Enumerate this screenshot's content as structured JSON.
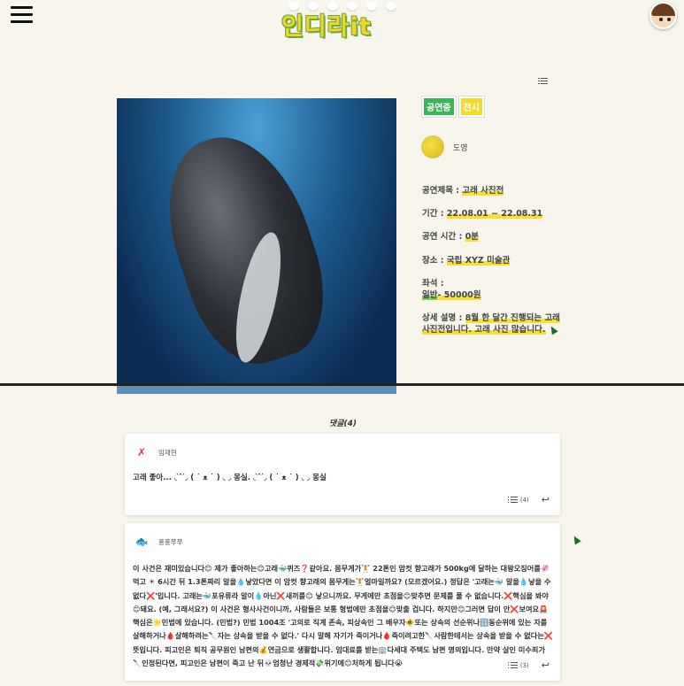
{
  "header": {
    "logo_text": "인디라it",
    "menu_icon": "hamburger-icon",
    "profile_icon": "user-avatar-icon"
  },
  "post": {
    "badges": [
      "공연중",
      "전시"
    ],
    "author": "도영",
    "title_label": "공연제목 : ",
    "title_value": "고래 사진전",
    "period_label": "기간 : ",
    "period_value": "22.08.01 ~ 22.08.31",
    "runtime_label": "공연 시간 : ",
    "runtime_value": "0분",
    "place_label": "장소 : ",
    "place_value": "국립 XYZ 미술관",
    "seat_label": "좌석 : ",
    "seat_type": "일반",
    "seat_price": "- 50000원",
    "desc_label": "상세 설명 : ",
    "desc_value": "8월 한 달간 진행되는 고래 사진전입니다. 고래 사진 많습니다.",
    "poster_alt": "humpback whale underwater photo"
  },
  "comments": {
    "title": "댓글(4)",
    "items": [
      {
        "author": "임재현",
        "text": "고래 좋아... ◟ ̀ ̂ ́◞ ( ˙ ᴥ ˙ ) ◟ ◞ 몽실. ◟ ̀ ̂ ́◞ ( ˙ ᴥ ˙ ) ◟ ◞ 몽실",
        "replies": "(4)"
      },
      {
        "author": "홍홍쭈쭈",
        "text": "이 사건은 재미있습니다😊 제가 좋아하는😊고래🐳퀴즈❓같아요. 몸무게가🏋 22톤인 암컷 향고래가 500kg에 달하는 대왕오징어를🦑 먹고 ☀ 6시간 뒤 1.3톤짜리 알을💧낳았다면 이 암컷 향고래의 몸무게는🏋얼마일까요? (모르겠어요.) 정답은 '고래는🐳 알을💧낳을 수 없다❌'입니다. 고래는🐳포유류라 알이💧아닌❌새끼를😊 낳으니까요. 무게에만 초점을😊맞추면 문제를 풀 수 없습니다.❌핵심을 봐야😊돼요. (예, 그래서요?) 이 사건은 형사사건이니까, 사람들은 보통 형법에만 초점을😊맞출 겁니다. 하지만😊그러면 답이 안❌보여요🚨핵심은🌟민법에 있습니다. (민법?) 민법 1004조 '고의로 직계 존속, 피상속인 그 배우자🚸또는 상속의 선순위나🔢동순위에 있는 자를 살해하거나🩸살해하려는🔪자는 상속을 받을 수 없다.' 다시 말해 자기가 죽이거나🩸죽이려고한🔪사람한테서는 상속을 받을 수 없다는❌뜻입니다. 피고인은 퇴직 공무원인 남편의💰연금으로 생활합니다. 임대료를 받는🏢다세대 주택도 남편 명의입니다. 만약 살인 미수죄가🔪인정된다면, 피고인은 남편이 죽고 난 뒤💀엄청난 경제적💸위기에😊처하게 됩니다😭",
        "replies": "(3)"
      }
    ]
  },
  "colors": {
    "background": "#f7f5ec",
    "highlight_yellow": "#f7df33",
    "highlight_green": "#7cd15a",
    "badge_green": "#3cb45a",
    "badge_yellow": "#f2dd2a"
  }
}
